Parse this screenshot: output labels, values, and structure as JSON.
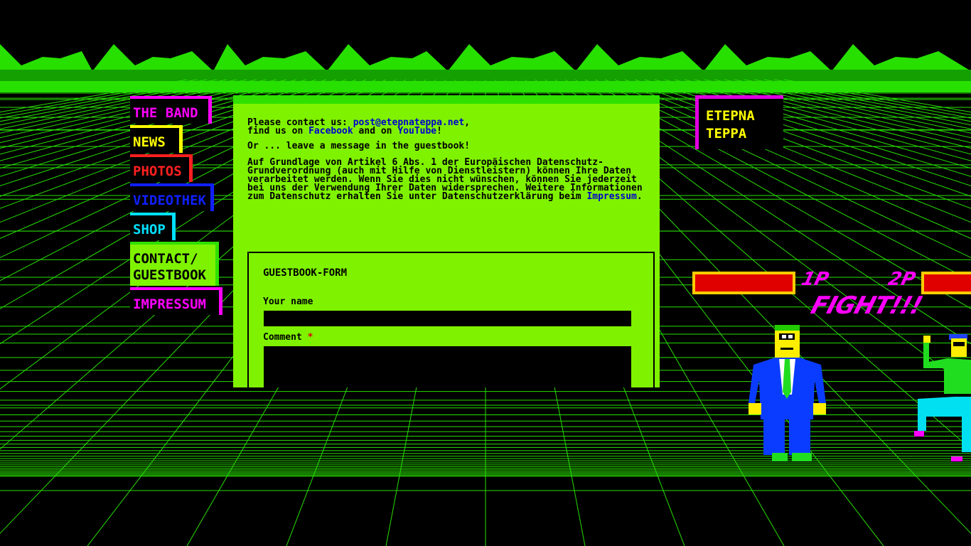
{
  "colors": {
    "grid": "#27e000",
    "panel": "#7ff200",
    "panel_top": "#2fe000",
    "link": "#0000d0",
    "accent": "#ff00ff"
  },
  "nav": {
    "items": [
      {
        "label": "THE BAND",
        "color": "#ff00ff"
      },
      {
        "label": "NEWS",
        "color": "#ffff00"
      },
      {
        "label": "PHOTOS",
        "color": "#ff2020"
      },
      {
        "label": "VIDEOTHEK",
        "color": "#1020ff"
      },
      {
        "label": "SHOP",
        "color": "#00e0ff"
      },
      {
        "label": "CONTACT/ GUESTBOOK",
        "color": "#7ff200"
      },
      {
        "label": "IMPRESSUM",
        "color": "#ff00ff"
      }
    ]
  },
  "logo": {
    "line1": "ETEPNA",
    "line2": "TEPPA"
  },
  "content": {
    "contact_prefix": "Please contact us: ",
    "email": "post@etepnateppa.net",
    "contact_comma": ",",
    "find_prefix": "find us on ",
    "facebook": "Facebook",
    "find_mid": " and on ",
    "youtube": "YouTube",
    "find_suffix": "!",
    "guestbook_hint": "Or ... leave a message in the guestbook!",
    "privacy_text": "Auf Grundlage von Artikel 6 Abs. 1 der Europäischen Datenschutz-Grundverordnung (auch mit Hilfe von Dienstleistern) können Ihre Daten verarbeitet werden. Wenn Sie dies nicht wünschen, können Sie jederzeit bei uns der Verwendung Ihrer Daten widersprechen. Weitere Informationen zum Datenschutz erhalten Sie unter Datenschutzerklärung beim ",
    "impressum_link": "Impressum",
    "privacy_end": "."
  },
  "form": {
    "title": "GUESTBOOK-FORM",
    "name_label": "Your name",
    "name_value": "",
    "comment_label": "Comment ",
    "required_mark": "*",
    "comment_value": ""
  },
  "game": {
    "p1_tag": "1P",
    "p2_tag": "2P",
    "fight": "FIGHT!!!",
    "p1_health": 1.0,
    "p2_health": 1.0
  }
}
